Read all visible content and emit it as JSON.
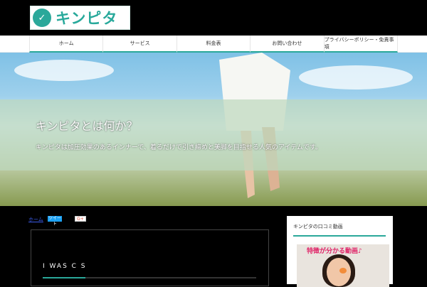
{
  "header": {
    "logo_mark": "✓",
    "logo_text": "キンピタ"
  },
  "nav": {
    "items": [
      "ホーム",
      "サービス",
      "料金表",
      "お問い合わせ",
      "プライバシーポリシー・免責事項"
    ]
  },
  "hero": {
    "title": "キンピタとは何か？",
    "subtitle": "キンピタは加圧効果のあるインナーで、着るだけで引き締めと美脚を目指せる人気のアイテムです。"
  },
  "content": {
    "breadcrumb": "ホーム",
    "share_twitter": "ツイート",
    "share_gplus": "G+",
    "article_heading": "I WAS C S"
  },
  "sidebar": {
    "title": "キンピタの口コミ動画",
    "video_caption": "特徴が分かる動画♪"
  },
  "colors": {
    "accent": "#2aa89a",
    "link": "#3b5be8"
  }
}
